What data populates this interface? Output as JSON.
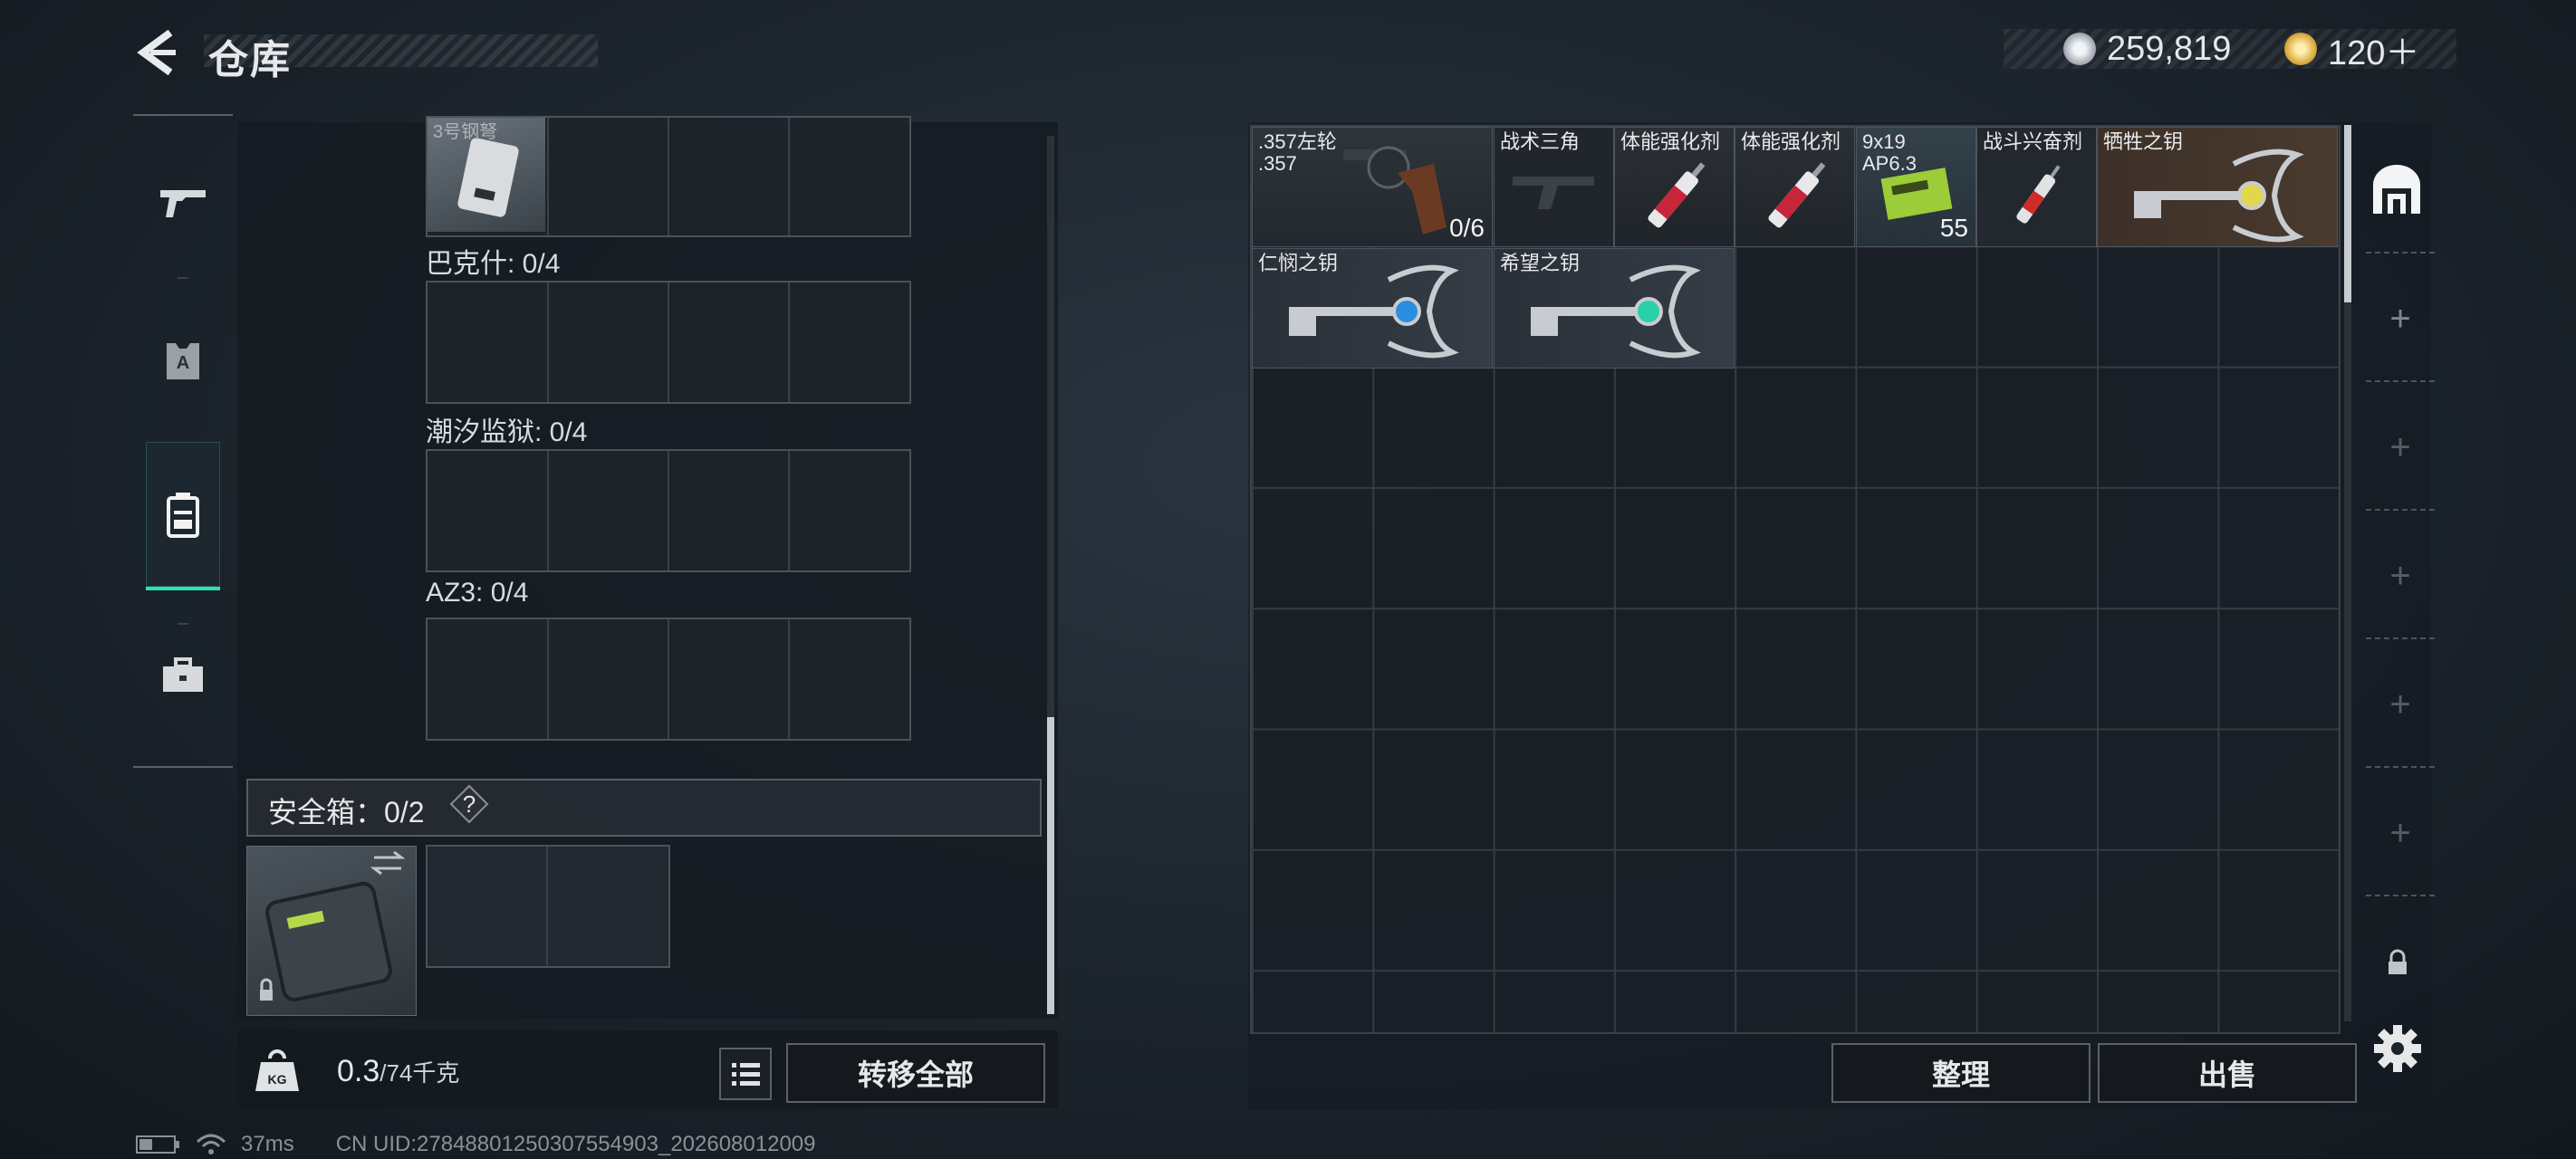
{
  "header": {
    "title": "仓库",
    "currency1_value": "259,819",
    "currency1_icon": "silver-coin-icon",
    "currency2_value": "120＋",
    "currency2_icon": "gold-coin-icon"
  },
  "nav": {
    "items": [
      {
        "name": "weapon-icon"
      },
      {
        "name": "armor-icon"
      },
      {
        "name": "backpack-icon",
        "active": true
      },
      {
        "name": "toolbox-icon"
      }
    ],
    "accent": "#2fe0b0"
  },
  "left_panel": {
    "top_slot_label": "3号钢弩",
    "containers": [
      {
        "label": "巴克什: 0/4"
      },
      {
        "label": "潮汐监狱: 0/4"
      },
      {
        "label": "AZ3: 0/4"
      }
    ],
    "safe_box_label": "安全箱：0/2",
    "safe_help": "?",
    "weight_current": "0.3",
    "weight_max": "/74千克",
    "transfer_all": "转移全部"
  },
  "grid_items": [
    {
      "name": ".357左轮\n.357",
      "count": "0/6"
    },
    {
      "name": "战术三角",
      "count": ""
    },
    {
      "name": "体能强化剂",
      "count": ""
    },
    {
      "name": "体能强化剂",
      "count": ""
    },
    {
      "name": "9x19\nAP6.3",
      "count": "55"
    },
    {
      "name": "战斗兴奋剂",
      "count": ""
    },
    {
      "name": "牺牲之钥",
      "count": ""
    },
    {
      "name": "仁悯之钥",
      "count": ""
    },
    {
      "name": "希望之钥",
      "count": ""
    }
  ],
  "actions": {
    "arrange": "整理",
    "sell": "出售"
  },
  "status_bar": {
    "ping": "37ms",
    "uid": "CN UID:2784880125030755490​3_202608012009"
  }
}
